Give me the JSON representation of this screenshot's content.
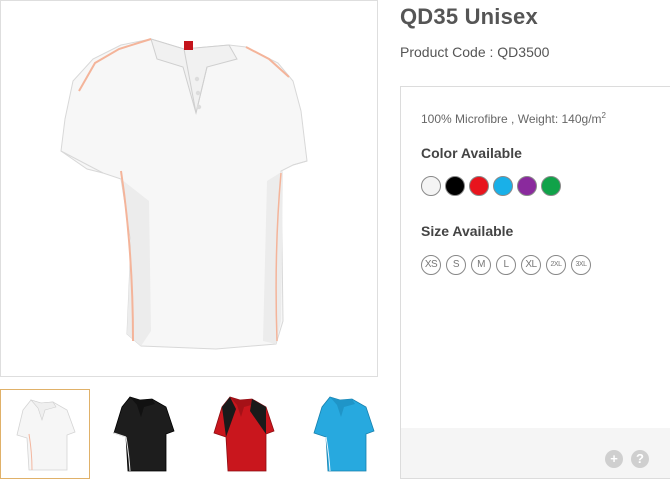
{
  "product": {
    "title": "QD35 Unisex",
    "code_label": "Product Code :",
    "code_value": "QD3500"
  },
  "specs": {
    "material": "100% Microfibre , Weight: 140g/m",
    "unit_sup": "2"
  },
  "colors": {
    "heading": "Color Available",
    "swatches": [
      {
        "name": "white",
        "hex": "#f4f4f4"
      },
      {
        "name": "black",
        "hex": "#000000"
      },
      {
        "name": "red",
        "hex": "#e8141d"
      },
      {
        "name": "sky-blue",
        "hex": "#19b0e8"
      },
      {
        "name": "purple",
        "hex": "#8a2a9d"
      },
      {
        "name": "green",
        "hex": "#10a249"
      }
    ]
  },
  "sizes": {
    "heading": "Size Available",
    "items": [
      "XS",
      "S",
      "M",
      "L",
      "XL",
      "2XL",
      "3XL"
    ]
  },
  "thumbnails": [
    {
      "color": "white",
      "body": "#f6f6f6",
      "accent": "#f3b7a0",
      "selected": true
    },
    {
      "color": "black",
      "body": "#1a1a1a",
      "accent": "#e8e8e8",
      "selected": false
    },
    {
      "color": "red",
      "body": "#c9161d",
      "accent": "#1a1a1a",
      "selected": false
    },
    {
      "color": "sky-blue",
      "body": "#27a9df",
      "accent": "#e8f4fb",
      "selected": false
    }
  ],
  "footer": {
    "add_icon": "+",
    "help_icon": "?"
  }
}
